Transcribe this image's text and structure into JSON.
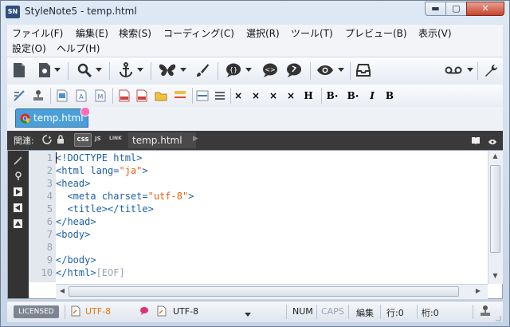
{
  "window": {
    "app_icon_text": "SN",
    "title": "StyleNote5 - temp.html",
    "min_glyph": "▬",
    "max_glyph": "▢",
    "close_glyph": "✕"
  },
  "menu": [
    {
      "label": "ファイル(F)",
      "name": "menu-file"
    },
    {
      "label": "編集(E)",
      "name": "menu-edit"
    },
    {
      "label": "検索(S)",
      "name": "menu-search"
    },
    {
      "label": "コーディング(C)",
      "name": "menu-coding"
    },
    {
      "label": "選択(R)",
      "name": "menu-select"
    },
    {
      "label": "ツール(T)",
      "name": "menu-tools"
    },
    {
      "label": "プレビュー(B)",
      "name": "menu-preview"
    },
    {
      "label": "表示(V)",
      "name": "menu-view"
    },
    {
      "label": "設定(O)",
      "name": "menu-settings"
    },
    {
      "label": "ヘルプ(H)",
      "name": "menu-help"
    }
  ],
  "toolbar2_text": {
    "bold": "H",
    "b_sup": "B",
    "b_sub": "B",
    "italic": "I",
    "bold2": "B",
    "x": "×"
  },
  "tab": {
    "label": "temp.html"
  },
  "related_bar": {
    "label": "関連:",
    "css": "CSS",
    "js": "JS",
    "link": "LINK",
    "file": "temp.html"
  },
  "editor": {
    "line_numbers": [
      "1",
      "2",
      "3",
      "4",
      "5",
      "6",
      "7",
      "8",
      "9",
      "10"
    ],
    "lines": [
      {
        "pre": "<!DOCTYPE html>",
        "val": "",
        "post": ""
      },
      {
        "pre": "<html lang=",
        "val": "\"ja\"",
        "post": ">"
      },
      {
        "pre": "<head>",
        "val": "",
        "post": ""
      },
      {
        "pre": "  <meta charset=",
        "val": "\"utf-8\"",
        "post": ">"
      },
      {
        "pre": "  <title></title>",
        "val": "",
        "post": ""
      },
      {
        "pre": "</head>",
        "val": "",
        "post": ""
      },
      {
        "pre": "<body>",
        "val": "",
        "post": ""
      },
      {
        "pre": "",
        "val": "",
        "post": ""
      },
      {
        "pre": "</body>",
        "val": "",
        "post": ""
      },
      {
        "pre": "</html>",
        "val": "",
        "post": ""
      }
    ],
    "eof": "[EOF]"
  },
  "status": {
    "licensed": "LICENSED",
    "encoding1": "UTF-8",
    "encoding2": "UTF-8",
    "num": "NUM",
    "caps": "CAPS",
    "mode": "編集",
    "row": "行:0",
    "col": "桁:0"
  },
  "colors": {
    "accent": "#4b9fd8",
    "tag": "#1c5fa8",
    "attr_value": "#e86010",
    "encoding1": "#e8760c"
  }
}
